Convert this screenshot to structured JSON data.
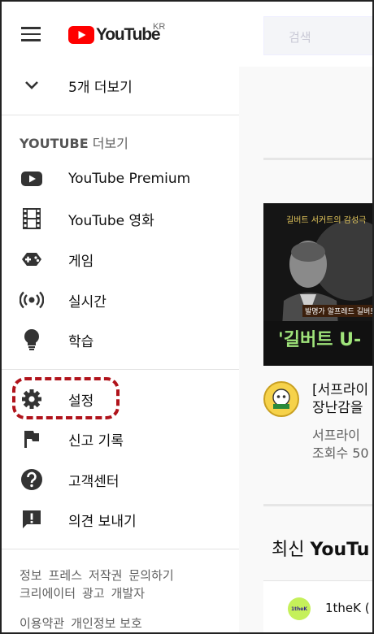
{
  "header": {
    "logo_text": "YouTube",
    "country_code": "KR",
    "search_placeholder": "검색"
  },
  "sidebar": {
    "show_more": "5개 더보기",
    "section_title_bold": "YOUTUBE",
    "section_title_rest": " 더보기",
    "more_items": [
      {
        "label": "YouTube Premium",
        "icon": "youtube-play-icon"
      },
      {
        "label": "YouTube 영화",
        "icon": "film-icon"
      },
      {
        "label": "게임",
        "icon": "gamepad-icon"
      },
      {
        "label": "실시간",
        "icon": "live-broadcast-icon"
      },
      {
        "label": "학습",
        "icon": "lightbulb-icon"
      }
    ],
    "settings_items": [
      {
        "label": "설정",
        "icon": "gear-icon"
      },
      {
        "label": "신고 기록",
        "icon": "flag-icon"
      },
      {
        "label": "고객센터",
        "icon": "help-icon"
      },
      {
        "label": "의견 보내기",
        "icon": "feedback-icon"
      }
    ],
    "footer_line1": [
      "정보",
      "프레스",
      "저작권",
      "문의하기"
    ],
    "footer_line2": [
      "크리에이터",
      "광고",
      "개발자"
    ],
    "footer_line3": [
      "이용약관",
      "개인정보 보호"
    ]
  },
  "main": {
    "thumbnail_caption_top": "길버트 서커트의 감성극",
    "thumbnail_caption_mid": "발명가 알프레드 길버트",
    "thumbnail_caption_big": "'길버트 U-",
    "video_title_line1": "[서프라이",
    "video_title_line2": "장난감을",
    "video_channel": "서프라이",
    "video_views": "조회수 50",
    "shelf_title_prefix": "최신 ",
    "shelf_title_bold": "YouTu",
    "card_channel": "1theK (",
    "card_avatar_text": "1theK"
  },
  "colors": {
    "brand_red": "#ff0000",
    "highlight": "#b0131b"
  }
}
